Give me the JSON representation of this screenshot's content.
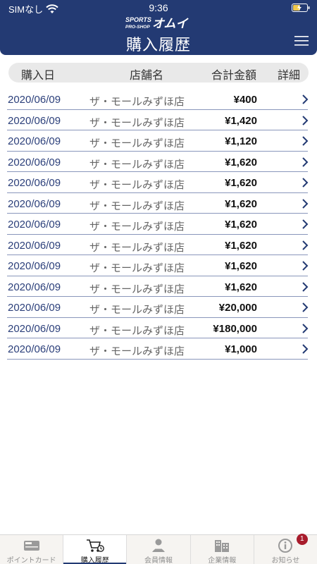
{
  "status": {
    "carrier": "SIMなし",
    "time": "9:36"
  },
  "header": {
    "logo_text": "SPORTS PRO-SHOP オムイ",
    "title": "購入履歴"
  },
  "table": {
    "columns": [
      "購入日",
      "店舗名",
      "合計金額",
      "詳細"
    ],
    "rows": [
      {
        "date": "2020/06/09",
        "store": "ザ・モールみずほ店",
        "amount": "¥400"
      },
      {
        "date": "2020/06/09",
        "store": "ザ・モールみずほ店",
        "amount": "¥1,420"
      },
      {
        "date": "2020/06/09",
        "store": "ザ・モールみずほ店",
        "amount": "¥1,120"
      },
      {
        "date": "2020/06/09",
        "store": "ザ・モールみずほ店",
        "amount": "¥1,620"
      },
      {
        "date": "2020/06/09",
        "store": "ザ・モールみずほ店",
        "amount": "¥1,620"
      },
      {
        "date": "2020/06/09",
        "store": "ザ・モールみずほ店",
        "amount": "¥1,620"
      },
      {
        "date": "2020/06/09",
        "store": "ザ・モールみずほ店",
        "amount": "¥1,620"
      },
      {
        "date": "2020/06/09",
        "store": "ザ・モールみずほ店",
        "amount": "¥1,620"
      },
      {
        "date": "2020/06/09",
        "store": "ザ・モールみずほ店",
        "amount": "¥1,620"
      },
      {
        "date": "2020/06/09",
        "store": "ザ・モールみずほ店",
        "amount": "¥1,620"
      },
      {
        "date": "2020/06/09",
        "store": "ザ・モールみずほ店",
        "amount": "¥20,000"
      },
      {
        "date": "2020/06/09",
        "store": "ザ・モールみずほ店",
        "amount": "¥180,000"
      },
      {
        "date": "2020/06/09",
        "store": "ザ・モールみずほ店",
        "amount": "¥1,000"
      }
    ]
  },
  "tabbar": {
    "tabs": [
      {
        "label": "ポイントカード",
        "icon": "point-card-icon",
        "active": false
      },
      {
        "label": "購入履歴",
        "icon": "cart-history-icon",
        "active": true
      },
      {
        "label": "会員情報",
        "icon": "member-icon",
        "active": false
      },
      {
        "label": "企業情報",
        "icon": "building-icon",
        "active": false
      },
      {
        "label": "お知らせ",
        "icon": "info-icon",
        "active": false,
        "badge": "1"
      }
    ]
  },
  "colors": {
    "brand": "#233a73",
    "badge": "#a81c2c"
  }
}
